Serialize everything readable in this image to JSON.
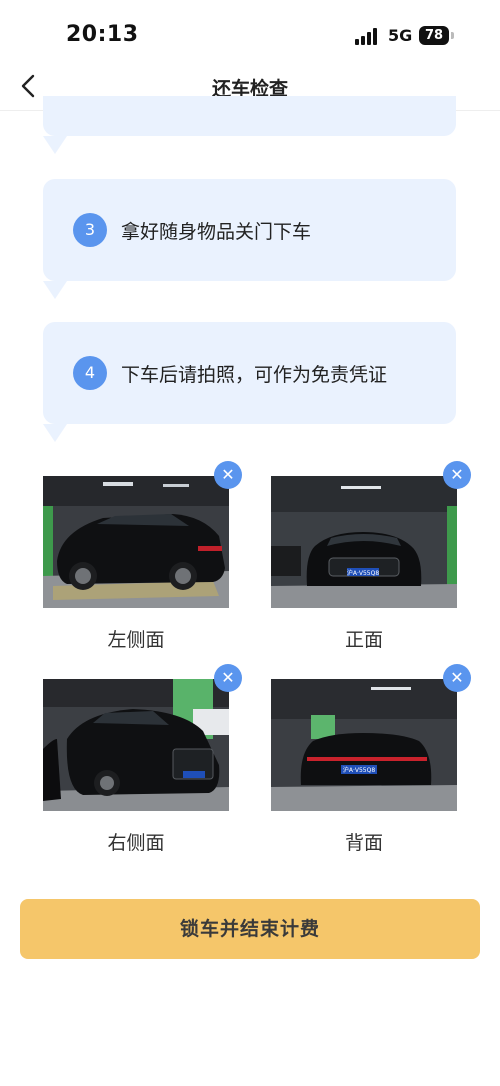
{
  "status_bar": {
    "time": "20:13",
    "network": "5G",
    "battery": "78"
  },
  "nav": {
    "title": "还车检查"
  },
  "steps": [
    {
      "number": "3",
      "text": "拿好随身物品关门下车"
    },
    {
      "number": "4",
      "text": "下车后请拍照，可作为免责凭证"
    }
  ],
  "photos": [
    {
      "label": "左侧面",
      "remove_icon": "close-icon"
    },
    {
      "label": "正面",
      "remove_icon": "close-icon"
    },
    {
      "label": "右侧面",
      "remove_icon": "close-icon"
    },
    {
      "label": "背面",
      "remove_icon": "close-icon"
    }
  ],
  "photo_plates": {
    "front": "沪A·V55Q8",
    "rear": "沪A·V55Q8"
  },
  "actions": {
    "submit_label": "锁车并结束计费"
  },
  "colors": {
    "accent": "#5a95ee",
    "bubble": "#eaf2fe",
    "button": "#f5c66a"
  }
}
